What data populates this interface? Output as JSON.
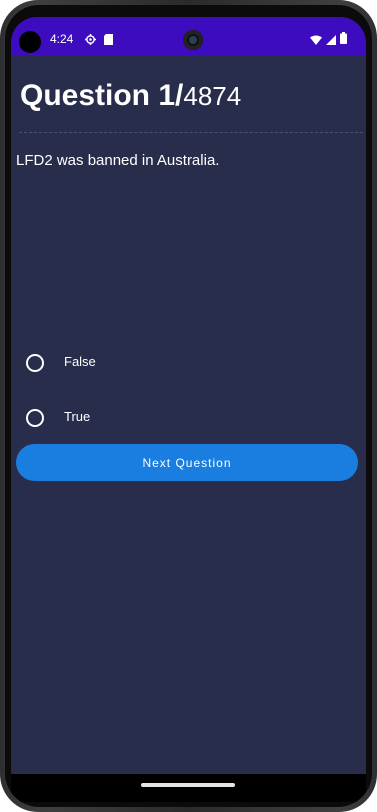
{
  "status_bar": {
    "time": "4:24",
    "left_icons": [
      "settings-gear-icon",
      "sd-card-icon"
    ],
    "right_icons": [
      "wifi-icon",
      "signal-icon",
      "battery-icon"
    ],
    "background_color": "#3d0cbf"
  },
  "quiz": {
    "title_prefix": "Question 1/",
    "total_questions": "4874",
    "question_text": "LFD2 was banned in Australia.",
    "options": [
      {
        "label": "False",
        "selected": false
      },
      {
        "label": "True",
        "selected": false
      }
    ],
    "next_button_label": "Next Question"
  },
  "colors": {
    "screen_background": "#272d4a",
    "button_background": "#1a7de0",
    "text": "#ffffff"
  }
}
